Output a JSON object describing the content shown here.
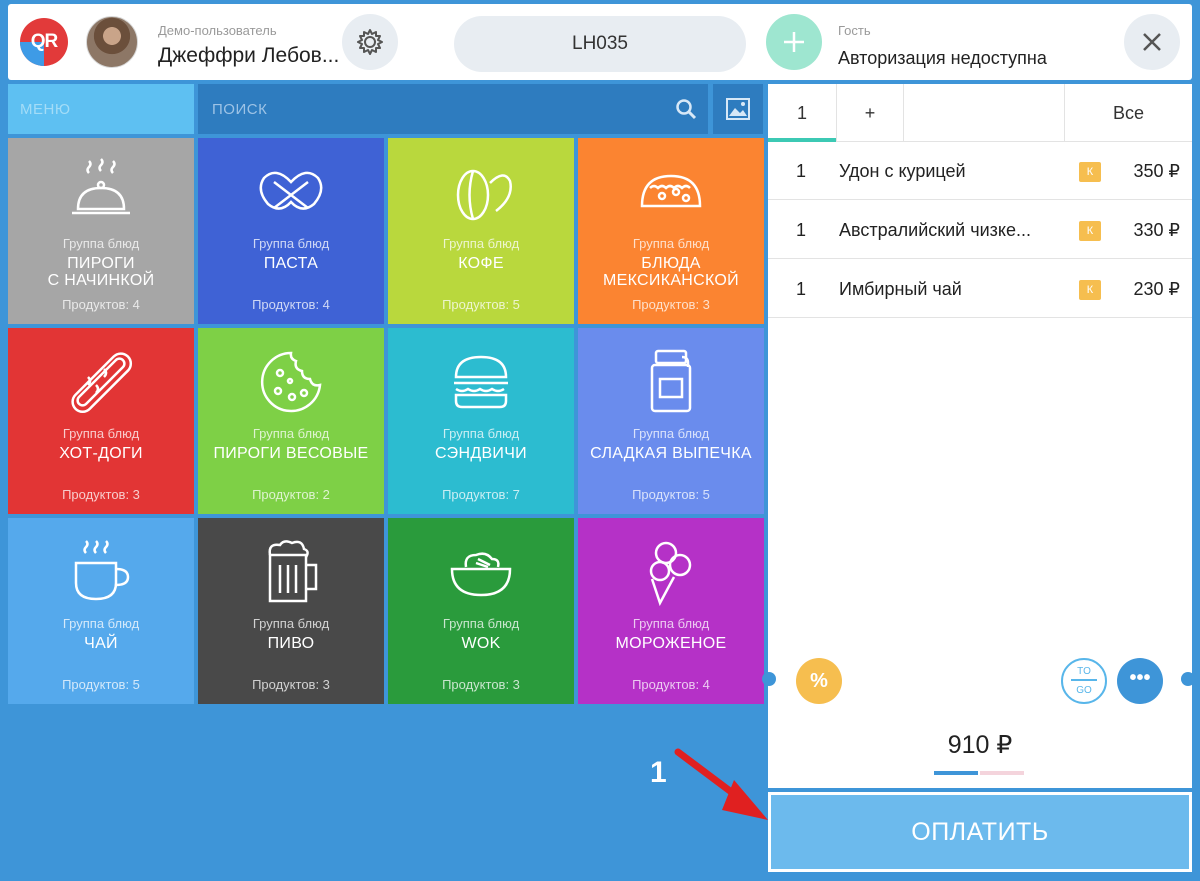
{
  "header": {
    "logo_text": "QR",
    "user_role": "Демо-пользователь",
    "user_name": "Джеффри Лебов...",
    "order_id": "LH035",
    "guest_label": "Гость",
    "guest_status": "Авторизация недоступна"
  },
  "toolbar": {
    "menu_label": "МЕНЮ",
    "search_placeholder": "ПОИСК"
  },
  "tiles": [
    {
      "subtitle": "Группа блюд",
      "name": "ПИРОГИ\nС НАЧИНКОЙ",
      "count": "Продуктов: 4",
      "color": "#a6a6a6",
      "icon": "cloche-icon"
    },
    {
      "subtitle": "Группа блюд",
      "name": "ПАСТА",
      "count": "Продуктов: 4",
      "color": "#3f62d5",
      "icon": "pretzel-icon"
    },
    {
      "subtitle": "Группа блюд",
      "name": "КОФЕ",
      "count": "Продуктов: 5",
      "color": "#b9d83d",
      "icon": "coffee-bean-icon"
    },
    {
      "subtitle": "Группа блюд",
      "name": "БЛЮДА\nМЕКСИКАНСКОЙ",
      "count": "Продуктов: 3",
      "color": "#fb8431",
      "icon": "taco-icon"
    },
    {
      "subtitle": "Группа блюд",
      "name": "ХОТ-ДОГИ",
      "count": "Продуктов: 3",
      "color": "#e23535",
      "icon": "hotdog-icon"
    },
    {
      "subtitle": "Группа блюд",
      "name": "ПИРОГИ ВЕСОВЫЕ",
      "count": "Продуктов: 2",
      "color": "#7ed046",
      "icon": "cookie-icon"
    },
    {
      "subtitle": "Группа блюд",
      "name": "СЭНДВИЧИ",
      "count": "Продуктов: 7",
      "color": "#2cbcd0",
      "icon": "burger-icon"
    },
    {
      "subtitle": "Группа блюд",
      "name": "СЛАДКАЯ ВЫПЕЧКА",
      "count": "Продуктов: 5",
      "color": "#6a8ced",
      "icon": "jam-jar-icon"
    },
    {
      "subtitle": "Группа блюд",
      "name": "ЧАЙ",
      "count": "Продуктов: 5",
      "color": "#55a9ec",
      "icon": "tea-cup-icon"
    },
    {
      "subtitle": "Группа блюд",
      "name": "ПИВО",
      "count": "Продуктов: 3",
      "color": "#494949",
      "icon": "beer-mug-icon"
    },
    {
      "subtitle": "Группа блюд",
      "name": "WOK",
      "count": "Продуктов: 3",
      "color": "#2a9b3c",
      "icon": "wok-bowl-icon"
    },
    {
      "subtitle": "Группа блюд",
      "name": "МОРОЖЕНОЕ",
      "count": "Продуктов: 4",
      "color": "#b531c7",
      "icon": "ice-cream-icon"
    }
  ],
  "order": {
    "tabs": {
      "guest": "1",
      "add": "+",
      "all": "Все"
    },
    "items": [
      {
        "qty": "1",
        "name": "Удон с курицей",
        "badge": "К",
        "price": "350 ₽"
      },
      {
        "qty": "1",
        "name": "Австралийский чизке...",
        "badge": "К",
        "price": "330 ₽"
      },
      {
        "qty": "1",
        "name": "Имбирный чай",
        "badge": "К",
        "price": "230 ₽"
      }
    ],
    "discount_symbol": "%",
    "togo_top": "TO",
    "togo_bottom": "GO",
    "more_symbol": "•••",
    "total": "910 ₽",
    "pay_label": "ОПЛАТИТЬ"
  },
  "annotation": {
    "step_number": "1"
  }
}
